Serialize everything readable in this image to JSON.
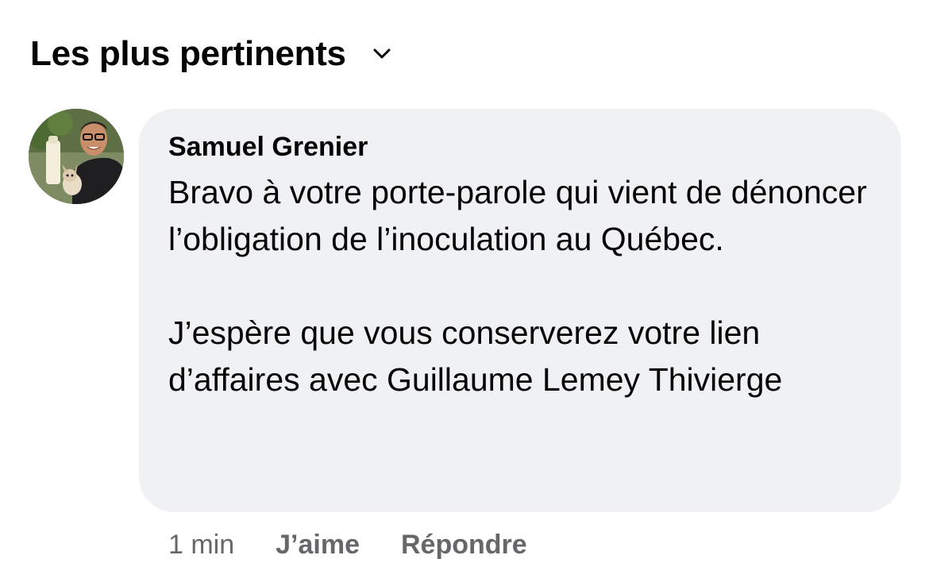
{
  "sort": {
    "label": "Les plus pertinents",
    "icon": "chevron-down-icon"
  },
  "comment": {
    "author": "Samuel Grenier",
    "avatar_icon": "profile-photo",
    "text": "Bravo à votre porte-parole qui vient de dénoncer l’obligation de l’inoculation au Québec.\n\nJ’espère que vous conserverez votre lien d’affaires avec Guillaume Lemey Thivierge",
    "timestamp": "1 min",
    "actions": {
      "like": "J’aime",
      "reply": "Répondre"
    }
  },
  "colors": {
    "bubble_background": "#f0f1f5",
    "secondary_text": "#65676b",
    "primary_text": "#050505"
  }
}
